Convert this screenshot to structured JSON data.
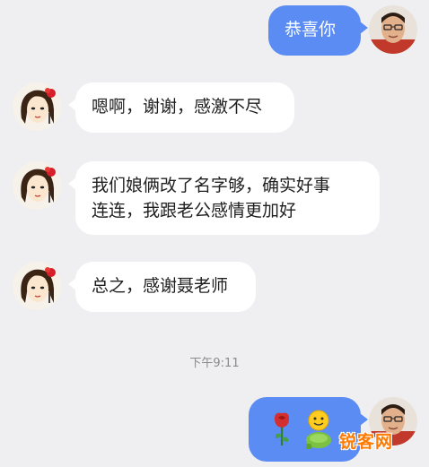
{
  "messages": [
    {
      "side": "out",
      "text": "恭喜你"
    },
    {
      "side": "in",
      "text": "嗯啊，谢谢，感激不尽"
    },
    {
      "side": "in",
      "line1": "我们娘俩改了名字够，确实好事",
      "line2": "连连，我跟老公感情更加好"
    },
    {
      "side": "in",
      "text": "总之，感谢聂老师"
    }
  ],
  "timestamp": "下午9:11",
  "sticker_message": {
    "side": "out",
    "emojis": [
      "rose-icon",
      "smiley-gift-icon"
    ]
  },
  "watermark": "锐客网",
  "colors": {
    "background": "#efeff2",
    "outgoing_bubble": "#5b8cf3",
    "incoming_bubble": "#ffffff",
    "timestamp_text": "#8a8a8a",
    "watermark": "#ff7a00"
  }
}
